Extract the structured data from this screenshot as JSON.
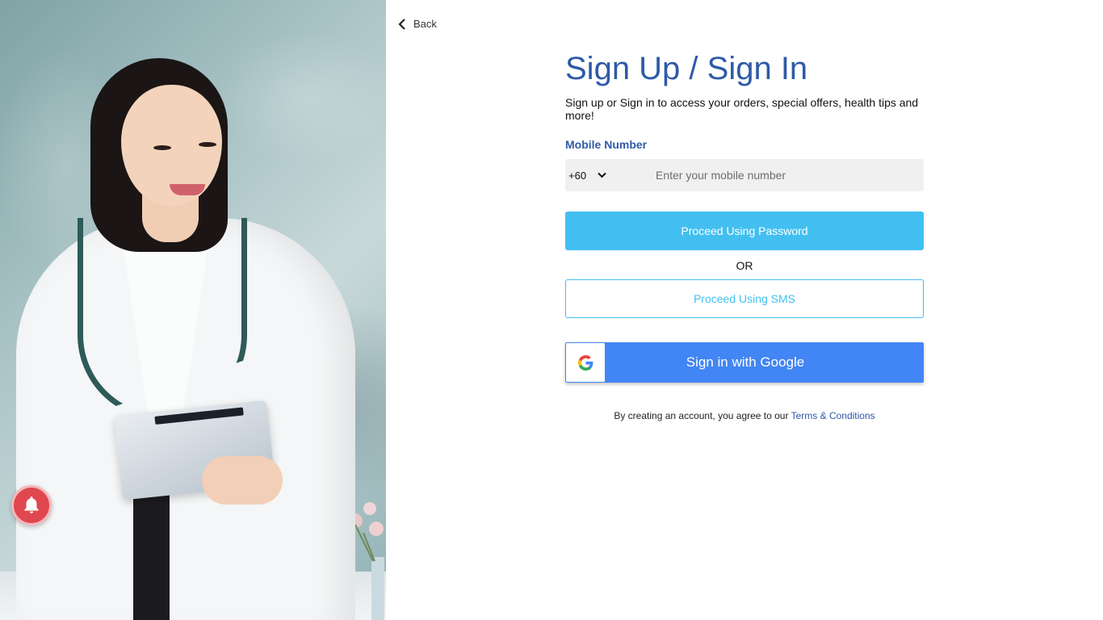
{
  "back": {
    "label": "Back"
  },
  "heading": {
    "title": "Sign Up / Sign In",
    "subtitle": "Sign up or Sign in to access your orders, special offers, health tips and more!"
  },
  "mobile": {
    "label": "Mobile Number",
    "country_code": "+60",
    "placeholder": "Enter your mobile number",
    "value": ""
  },
  "actions": {
    "password_button": "Proceed Using Password",
    "or_text": "OR",
    "sms_button": "Proceed Using SMS",
    "google_button": "Sign in with Google"
  },
  "terms": {
    "prefix": "By creating an account, you agree to our ",
    "link": "Terms & Conditions"
  },
  "icons": {
    "back": "chevron-left-icon",
    "dropdown": "chevron-down-icon",
    "google": "google-logo-icon",
    "notification": "bell-icon"
  },
  "colors": {
    "brand_blue": "#2e5aa8",
    "primary_button": "#42bff0",
    "google_blue": "#4285f4",
    "notification_red": "#e0474f",
    "input_bg": "#f0f0f0"
  }
}
